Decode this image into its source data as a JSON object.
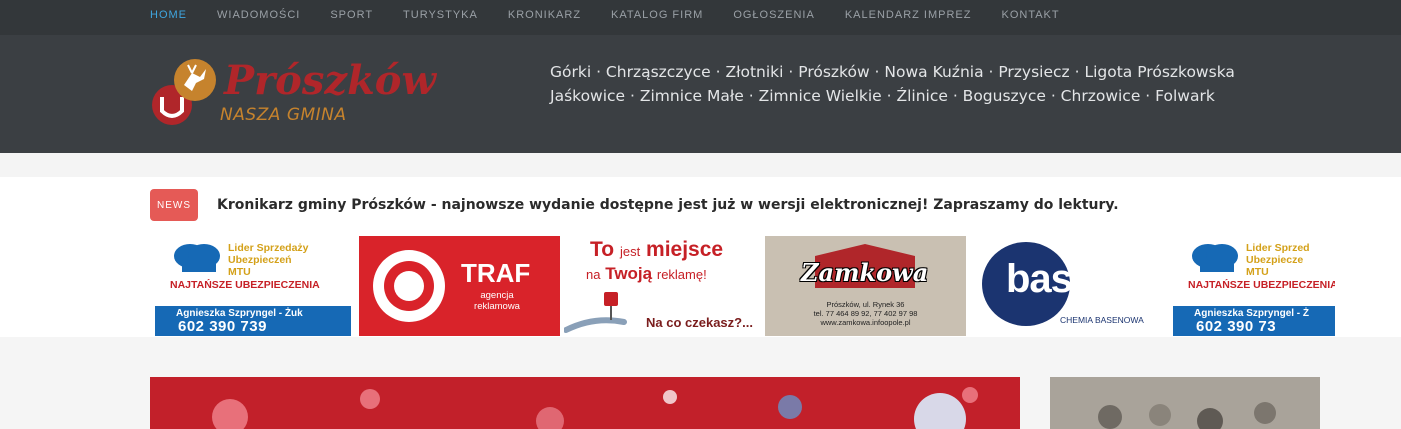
{
  "nav": {
    "items": [
      "HOME",
      "WIADOMOŚCI",
      "SPORT",
      "TURYSTYKA",
      "KRONIKARZ",
      "KATALOG FIRM",
      "OGŁOSZENIA",
      "KALENDARZ IMPREZ",
      "KONTAKT"
    ],
    "active_index": 0,
    "active_color": "#3fa6e0"
  },
  "header": {
    "logo": {
      "title": "Prószków",
      "subtitle": "NASZA GMINA"
    },
    "villages": {
      "line1": "Górki · Chrząszczyce · Złotniki · Prószków · Nowa Kuźnia · Przysiecz · Ligota Prószkowska",
      "line2": "Jaśkowice · Zimnice Małe · Zimnice Wielkie · Źlinice · Boguszyce · Chrzowice · Folwark"
    }
  },
  "ticker": {
    "badge": "NEWS",
    "badge_color": "#e55a56",
    "headline": "Kronikarz gminy Prószków - najnowsze wydanie dostępne jest już w wersji elektronicznej! Zapraszamy do lektury."
  },
  "banners": {
    "mtu": {
      "line1": "Lider Sprzedaży",
      "line2": "Ubezpieczeń",
      "line3": "MTU",
      "tagline": "NAJTAŃSZE UBEZPIECZENIA",
      "name": "Agnieszka Szpryngel - Żuk",
      "phone": "602 390 739"
    },
    "traf": {
      "word": "TRAF",
      "sub1": "agencja",
      "sub2": "reklamowa"
    },
    "reklama": {
      "to": "To",
      "jest": "jest",
      "miejsce": "miejsce",
      "na": "na",
      "twoja": "Twoją",
      "reklame": "reklamę!",
      "cta": "Na co czekasz?..."
    },
    "zamkowa": {
      "title": "Zamkowa",
      "addr1": "Prószków, ul. Rynek 36",
      "addr2": "tel. 77 464 89 92, 77 402 97 98",
      "addr3": "www.zamkowa.infoopole.pl"
    },
    "bassau": {
      "word": "bassau",
      "sub": "CHEMIA BASENOWA"
    },
    "mtu_repeat": {
      "line1": "Lider Sprzed",
      "line2": "Ubezpiecze",
      "line3": "MTU",
      "tagline": "NAJTAŃSZE UBEZPIECZENIA",
      "name": "Agnieszka Szpryngel - Ż",
      "phone": "602 390 73"
    }
  }
}
